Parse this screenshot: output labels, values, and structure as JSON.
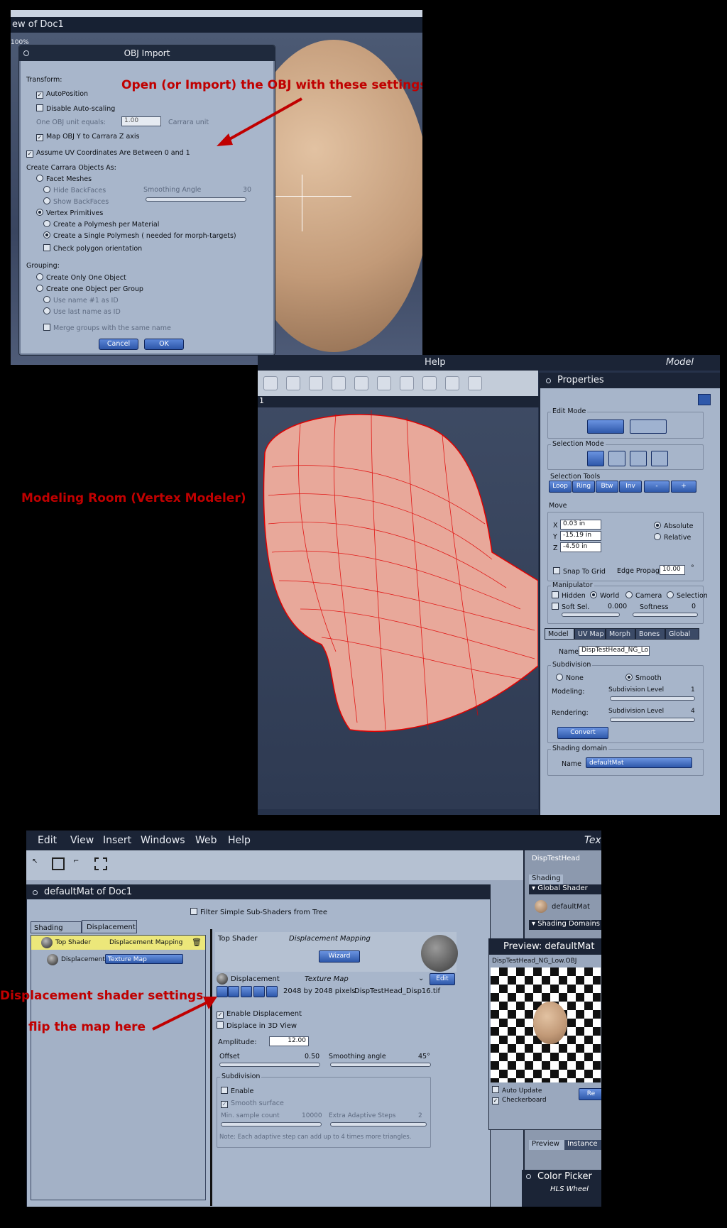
{
  "s1": {
    "view_title": "ew of Doc1",
    "zoom": "100%",
    "dialog": {
      "title": "OBJ Import",
      "transform_label": "Transform:",
      "auto_position": "AutoPosition",
      "disable_auto_scaling": "Disable Auto-scaling",
      "unit_label": "One OBJ unit equals:",
      "unit_value": "1.00",
      "unit_suffix": "Carrara unit",
      "map_axis": "Map OBJ Y to Carrara Z axis",
      "assume_uv": "Assume UV Coordinates Are Between 0 and 1",
      "create_label": "Create Carrara Objects As:",
      "facet_meshes": "Facet Meshes",
      "hide_backfaces": "Hide BackFaces",
      "show_backfaces": "Show BackFaces",
      "smoothing_angle_label": "Smoothing Angle",
      "smoothing_angle_value": "30",
      "vertex_primitives": "Vertex Primitives",
      "polymesh_per_material": "Create a Polymesh per Material",
      "single_polymesh": "Create a Single Polymesh ( needed for morph-targets)",
      "check_orientation": "Check polygon orientation",
      "grouping_label": "Grouping:",
      "only_one_object": "Create Only One Object",
      "one_per_group": "Create one Object per Group",
      "use_name_first": "Use name #1 as ID",
      "use_last_name": "Use last name as ID",
      "merge_groups": "Merge groups with the same name",
      "cancel": "Cancel",
      "ok": "OK"
    },
    "annotation": "Open (or Import) the OBJ with these settings"
  },
  "s2": {
    "menu_help": "Help",
    "room": "Model",
    "viewport_label": "1",
    "annotation": "Modeling Room (Vertex Modeler)",
    "properties": {
      "title": "Properties",
      "edit_mode": "Edit Mode",
      "selection_mode": "Selection Mode",
      "selection_tools": "Selection Tools",
      "tools": [
        "Loop",
        "Ring",
        "Btw",
        "Inv",
        "-",
        "+"
      ],
      "move": "Move",
      "x_label": "X",
      "x_value": "0.03 in",
      "y_label": "Y",
      "y_value": "-15.19 in",
      "z_label": "Z",
      "z_value": "-4.50 in",
      "absolute": "Absolute",
      "relative": "Relative",
      "snap": "Snap To Grid",
      "edge_propag": "Edge Propag.",
      "edge_propag_value": "10.00",
      "degree": "°",
      "manipulator": "Manipulator",
      "hidden": "Hidden",
      "world": "World",
      "camera": "Camera",
      "selection": "Selection",
      "soft_sel": "Soft Sel.",
      "soft_sel_value": "0.000",
      "softness": "Softness",
      "softness_value": "0",
      "tabs": [
        "Model",
        "UV Map",
        "Morph",
        "Bones",
        "Global"
      ],
      "name_label": "Name",
      "name_value": "DispTestHead_NG_Lo",
      "subdivision": "Subdivision",
      "none": "None",
      "smooth": "Smooth",
      "modeling": "Modeling:",
      "rendering": "Rendering:",
      "subdiv_level": "Subdivision Level",
      "modeling_level": "1",
      "rendering_level": "4",
      "convert": "Convert",
      "shading_domain": "Shading domain",
      "shading_name_label": "Name",
      "shading_name_value": "defaultMat"
    }
  },
  "s3": {
    "menu": [
      "Edit",
      "View",
      "Insert",
      "Windows",
      "Web",
      "Help"
    ],
    "menu_right": "Tex",
    "right_header": "DispTestHead",
    "right_tab": "Shading",
    "global_shader": "Global Shader",
    "default_mat": "defaultMat",
    "shading_domains": "Shading Domains",
    "window_title": "defaultMat of Doc1",
    "filter_label": "Filter Simple Sub-Shaders from Tree",
    "tabs": [
      "Shading",
      "Displacement"
    ],
    "tree": {
      "top_shader": "Top Shader",
      "top_type": "Displacement Mapping",
      "displacement": "Displacement",
      "disp_type": "Texture Map"
    },
    "details": {
      "top_shader": "Top Shader",
      "top_type": "Displacement Mapping",
      "wizard": "Wizard",
      "displacement": "Displacement",
      "disp_type": "Texture Map",
      "edit": "Edit",
      "pixels": "2048 by 2048 pixels",
      "file": "DispTestHead_Disp16.tif",
      "enable_displacement": "Enable Displacement",
      "displace_3d": "Displace in 3D View",
      "amplitude_label": "Amplitude:",
      "amplitude_value": "12.00",
      "offset_label": "Offset",
      "offset_value": "0.50",
      "smoothing_label": "Smoothing angle",
      "smoothing_value": "45°",
      "subdivision": "Subdivision",
      "enable": "Enable",
      "smooth_surface": "Smooth surface",
      "min_sample": "Min. sample count",
      "min_sample_value": "10000",
      "extra_steps": "Extra Adaptive Steps",
      "extra_steps_value": "2",
      "note": "Note: Each adaptive step can add up to 4 times more triangles."
    },
    "preview": {
      "title": "Preview: defaultMat",
      "object": "DispTestHead_NG_Low.OBJ",
      "auto_update": "Auto Update",
      "checkerboard": "Checkerboard",
      "render_btn": "Re",
      "tab_preview": "Preview",
      "tab_instance": "Instance"
    },
    "color_picker": "Color Picker",
    "hls_wheel": "HLS Wheel",
    "annotation_1": "Displacement shader settings",
    "annotation_2": "flip the map here"
  }
}
